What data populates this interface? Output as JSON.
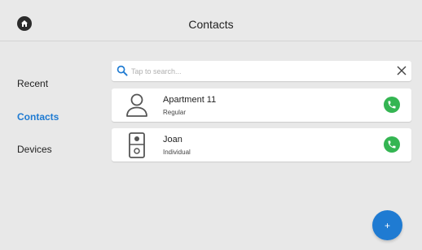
{
  "header": {
    "title": "Contacts",
    "home_icon": "home-icon"
  },
  "sidebar": {
    "items": [
      {
        "label": "Recent",
        "active": false
      },
      {
        "label": "Contacts",
        "active": true
      },
      {
        "label": "Devices",
        "active": false
      }
    ]
  },
  "search": {
    "placeholder": "Tap to search...",
    "value": "",
    "icon": "search-icon",
    "clear_icon": "close-icon"
  },
  "contacts": [
    {
      "name": "Apartment 11",
      "type": "Regular",
      "avatar_icon": "person-icon"
    },
    {
      "name": "Joan",
      "type": "Individual",
      "avatar_icon": "intercom-device-icon"
    }
  ],
  "fab": {
    "label": "+"
  },
  "colors": {
    "accent": "#1f7bd2",
    "call_green": "#34b552",
    "background": "#e8e8e8"
  }
}
